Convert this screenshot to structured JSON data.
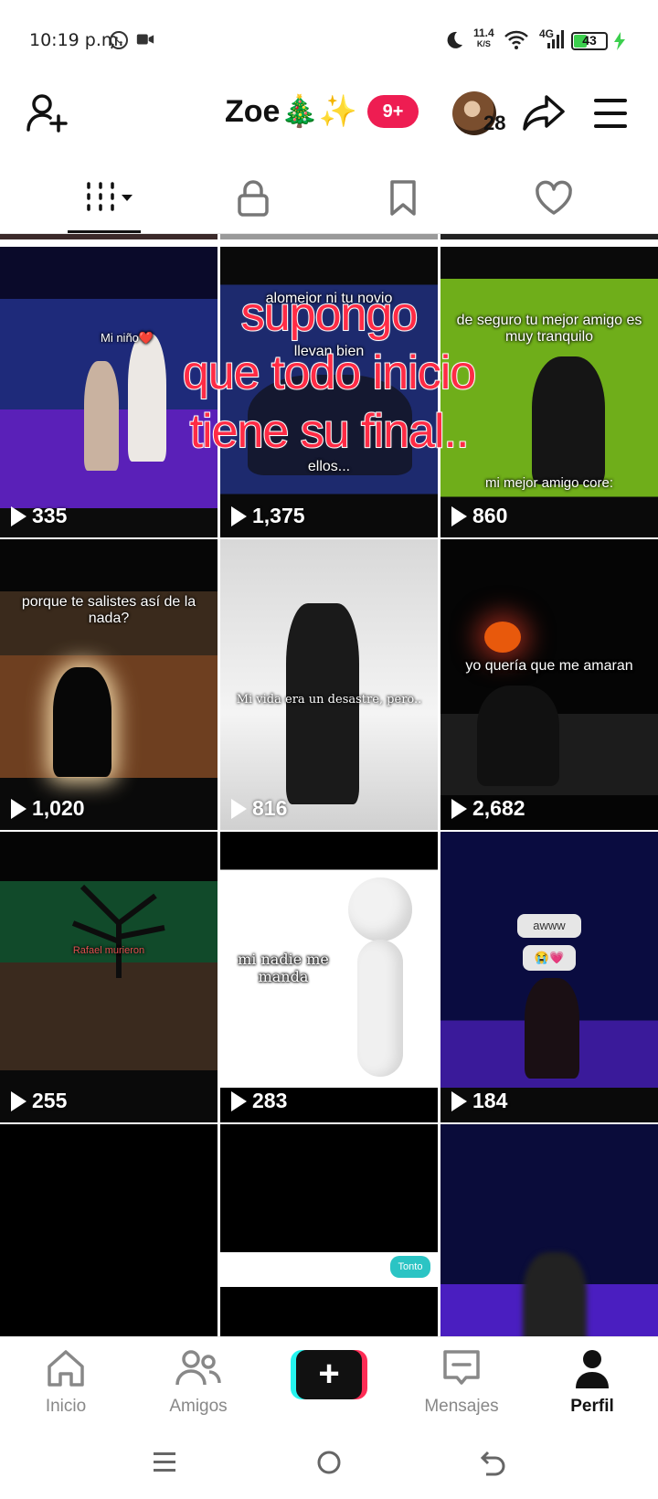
{
  "status_bar": {
    "time": "10:19 p.m.",
    "net_speed_value": "11.4",
    "net_speed_unit": "K/S",
    "network_type": "4G",
    "battery": "43",
    "icons": [
      "whatsapp-icon",
      "video-camera-icon",
      "moon-icon",
      "wifi-icon",
      "signal-icon",
      "battery-icon",
      "charging-icon"
    ]
  },
  "header": {
    "username": "Zoe🎄✨",
    "notification_badge": "9+",
    "friends_count": "28"
  },
  "tabs": [
    {
      "name": "videos-grid",
      "active": true
    },
    {
      "name": "private",
      "active": false
    },
    {
      "name": "saved",
      "active": false
    },
    {
      "name": "liked",
      "active": false
    }
  ],
  "overlay": {
    "lines": [
      "supongo",
      "que todo inicio",
      "tiene su final.."
    ]
  },
  "videos": [
    {
      "views": "335",
      "caption": "Mi niño❤️"
    },
    {
      "views": "1,375",
      "caption": "alomejor ni tu novio",
      "caption2": "llevan bien",
      "caption3": "ellos..."
    },
    {
      "views": "860",
      "caption": "de seguro tu mejor amigo es muy tranquilo",
      "caption2": "mi mejor amigo core:"
    },
    {
      "views": "1,020",
      "caption": "porque te salistes así de la nada?"
    },
    {
      "views": "816",
      "caption": "Mi vida era un desastre, pero.."
    },
    {
      "views": "2,682",
      "caption": "yo quería que me amaran"
    },
    {
      "views": "255",
      "caption": "Rafael murieron"
    },
    {
      "views": "283",
      "caption": "mi nadie me manda"
    },
    {
      "views": "184",
      "caption": "awww",
      "caption2": "😭💗"
    },
    {
      "views": "",
      "caption": ""
    },
    {
      "views": "",
      "caption": "Tonto"
    },
    {
      "views": "",
      "caption": ""
    }
  ],
  "bottom_nav": {
    "items": [
      {
        "label": "Inicio",
        "icon": "home-icon"
      },
      {
        "label": "Amigos",
        "icon": "friends-icon"
      },
      {
        "label": "Mensajes",
        "icon": "messages-icon"
      },
      {
        "label": "Perfil",
        "icon": "profile-icon"
      }
    ],
    "create_symbol": "+"
  },
  "colors": {
    "accent_red": "#ee1d52",
    "overlay_text": "#ff2b45",
    "battery_green": "#3ccf4e",
    "create_cyan": "#25f4ee",
    "create_pink": "#fe2c55"
  }
}
